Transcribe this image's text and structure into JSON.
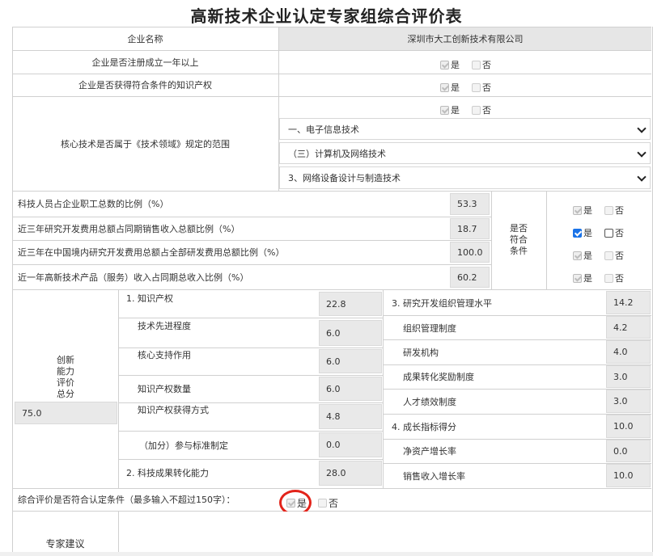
{
  "page": {
    "title": "高新技术企业认定专家组综合评价表"
  },
  "company": {
    "label": "企业名称",
    "value": "深圳市大工创新技术有限公司"
  },
  "options": {
    "yes": "是",
    "no": "否"
  },
  "questions": {
    "registered_one_year": "企业是否注册成立一年以上",
    "has_ip": "企业是否获得符合条件的知识产权",
    "core_tech": "核心技术是否属于《技术领域》规定的范围"
  },
  "core_tech_selects": [
    "一、电子信息技术",
    "（三）计算机及网络技术",
    "3、网络设备设计与制造技术"
  ],
  "ratios": [
    {
      "label": "科技人员占企业职工总数的比例（%）",
      "value": "53.3"
    },
    {
      "label": "近三年研究开发费用总额占同期销售收入总额比例（%）",
      "value": "18.7"
    },
    {
      "label": "近三年在中国境内研究开发费用总额占全部研发费用总额比例（%）",
      "value": "100.0"
    },
    {
      "label": "近一年高新技术产品（服务）收入占同期总收入比例（%）",
      "value": "60.2"
    }
  ],
  "conditions_label": "是否符合条件",
  "innovation": {
    "label": "创新能力评价总分",
    "total": "75.0",
    "left_items": [
      {
        "label": "1. 知识产权",
        "value": "22.8"
      },
      {
        "label": "技术先进程度",
        "value": "6.0"
      },
      {
        "label": "核心支持作用",
        "value": "6.0"
      },
      {
        "label": "知识产权数量",
        "value": "6.0"
      },
      {
        "label": "知识产权获得方式",
        "value": "4.8"
      },
      {
        "label": "（加分）参与标准制定",
        "value": "0.0"
      },
      {
        "label": "2. 科技成果转化能力",
        "value": "28.0"
      }
    ],
    "right_items": [
      {
        "label": "3. 研究开发组织管理水平",
        "value": "14.2"
      },
      {
        "label": "组织管理制度",
        "value": "4.2"
      },
      {
        "label": "研发机构",
        "value": "4.0"
      },
      {
        "label": "成果转化奖励制度",
        "value": "3.0"
      },
      {
        "label": "人才绩效制度",
        "value": "3.0"
      },
      {
        "label": "4. 成长指标得分",
        "value": "10.0"
      },
      {
        "label": "净资产增长率",
        "value": "0.0"
      },
      {
        "label": "销售收入增长率",
        "value": "10.0"
      }
    ]
  },
  "overall": {
    "label": "综合评价是否符合认定条件（最多输入不超过150字）："
  },
  "expert": {
    "label": "专家建议"
  }
}
